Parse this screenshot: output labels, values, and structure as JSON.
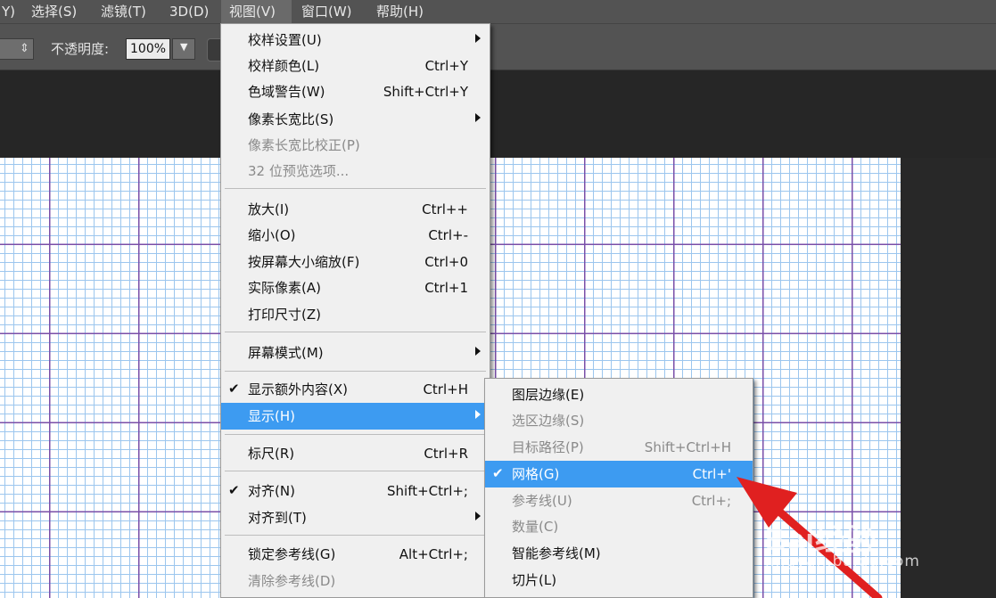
{
  "menubar": {
    "items": [
      "Y)",
      "选择(S)",
      "滤镜(T)",
      "3D(D)",
      "视图(V)",
      "窗口(W)",
      "帮助(H)"
    ]
  },
  "options": {
    "opacity_label": "不透明度:",
    "opacity_value": "100%"
  },
  "view_menu": {
    "items": [
      {
        "label": "校样设置(U)",
        "shortcut": "",
        "submenu": true
      },
      {
        "label": "校样颜色(L)",
        "shortcut": "Ctrl+Y"
      },
      {
        "label": "色域警告(W)",
        "shortcut": "Shift+Ctrl+Y"
      },
      {
        "label": "像素长宽比(S)",
        "shortcut": "",
        "submenu": true
      },
      {
        "label": "像素长宽比校正(P)",
        "shortcut": "",
        "disabled": true
      },
      {
        "label": "32 位预览选项...",
        "shortcut": "",
        "disabled": true
      },
      {
        "label": "放大(I)",
        "shortcut": "Ctrl++"
      },
      {
        "label": "缩小(O)",
        "shortcut": "Ctrl+-"
      },
      {
        "label": "按屏幕大小缩放(F)",
        "shortcut": "Ctrl+0"
      },
      {
        "label": "实际像素(A)",
        "shortcut": "Ctrl+1"
      },
      {
        "label": "打印尺寸(Z)",
        "shortcut": ""
      },
      {
        "label": "屏幕模式(M)",
        "shortcut": "",
        "submenu": true
      },
      {
        "label": "显示额外内容(X)",
        "shortcut": "Ctrl+H",
        "checked": true
      },
      {
        "label": "显示(H)",
        "shortcut": "",
        "submenu": true,
        "highlighted": true
      },
      {
        "label": "标尺(R)",
        "shortcut": "Ctrl+R"
      },
      {
        "label": "对齐(N)",
        "shortcut": "Shift+Ctrl+;",
        "checked": true
      },
      {
        "label": "对齐到(T)",
        "shortcut": "",
        "submenu": true
      },
      {
        "label": "锁定参考线(G)",
        "shortcut": "Alt+Ctrl+;"
      },
      {
        "label": "清除参考线(D)",
        "shortcut": "",
        "disabled": true
      }
    ]
  },
  "show_submenu": {
    "items": [
      {
        "label": "图层边缘(E)",
        "shortcut": ""
      },
      {
        "label": "选区边缘(S)",
        "shortcut": "",
        "disabled": true
      },
      {
        "label": "目标路径(P)",
        "shortcut": "Shift+Ctrl+H",
        "disabled": true
      },
      {
        "label": "网格(G)",
        "shortcut": "Ctrl+'",
        "checked": true,
        "highlighted": true
      },
      {
        "label": "参考线(U)",
        "shortcut": "Ctrl+;",
        "disabled": true
      },
      {
        "label": "数量(C)",
        "shortcut": "",
        "disabled": true
      },
      {
        "label": "智能参考线(M)",
        "shortcut": ""
      },
      {
        "label": "切片(L)",
        "shortcut": ""
      }
    ]
  },
  "watermark": {
    "brand": "Bai经验",
    "site": "jingyan.baidu.com"
  },
  "colors": {
    "menu_highlight": "#3d9bf1",
    "annotation_arrow": "#e02020",
    "grid_major": "#7a4fa8",
    "grid_minor": "#9cc6ee"
  }
}
